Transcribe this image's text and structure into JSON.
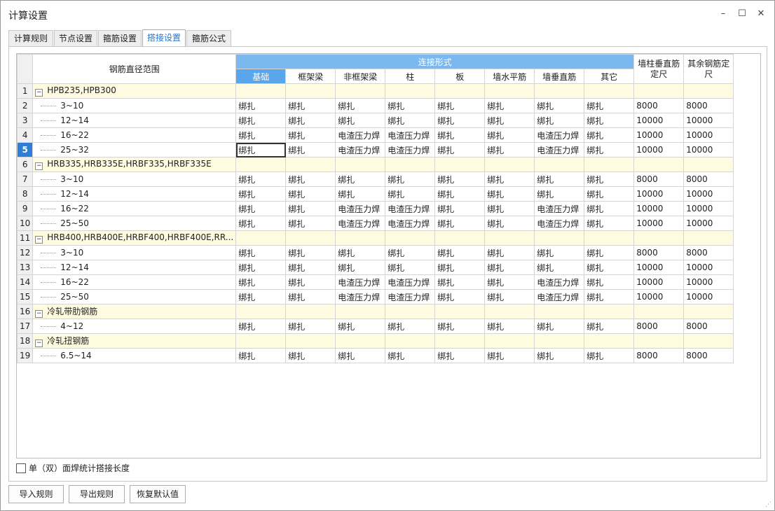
{
  "window": {
    "title": "计算设置",
    "minimize": "–",
    "maximize": "☐",
    "close": "✕"
  },
  "tabs": [
    {
      "label": "计算规则",
      "active": false
    },
    {
      "label": "节点设置",
      "active": false
    },
    {
      "label": "箍筋设置",
      "active": false
    },
    {
      "label": "搭接设置",
      "active": true
    },
    {
      "label": "箍筋公式",
      "active": false
    }
  ],
  "grid": {
    "range_header": "钢筋直径范围",
    "group_header": "连接形式",
    "columns": [
      "基础",
      "框架梁",
      "非框架梁",
      "柱",
      "板",
      "墙水平筋",
      "墙垂直筋",
      "其它"
    ],
    "extra_headers": [
      "墙柱垂直筋定尺",
      "其余钢筋定尺"
    ],
    "selected_row": 5,
    "focused_cell": {
      "row": 5,
      "col": 0
    },
    "rows": [
      {
        "num": "1",
        "type": "group",
        "range": "HPB235,HPB300",
        "values": [
          "",
          "",
          "",
          "",
          "",
          "",
          "",
          "",
          "",
          ""
        ]
      },
      {
        "num": "2",
        "type": "item",
        "range": "3~10",
        "values": [
          "绑扎",
          "绑扎",
          "绑扎",
          "绑扎",
          "绑扎",
          "绑扎",
          "绑扎",
          "绑扎",
          "8000",
          "8000"
        ]
      },
      {
        "num": "3",
        "type": "item",
        "range": "12~14",
        "values": [
          "绑扎",
          "绑扎",
          "绑扎",
          "绑扎",
          "绑扎",
          "绑扎",
          "绑扎",
          "绑扎",
          "10000",
          "10000"
        ]
      },
      {
        "num": "4",
        "type": "item",
        "range": "16~22",
        "values": [
          "绑扎",
          "绑扎",
          "电渣压力焊",
          "电渣压力焊",
          "绑扎",
          "绑扎",
          "电渣压力焊",
          "绑扎",
          "10000",
          "10000"
        ]
      },
      {
        "num": "5",
        "type": "item",
        "range": "25~32",
        "values": [
          "绑扎",
          "绑扎",
          "电渣压力焊",
          "电渣压力焊",
          "绑扎",
          "绑扎",
          "电渣压力焊",
          "绑扎",
          "10000",
          "10000"
        ]
      },
      {
        "num": "6",
        "type": "group",
        "range": "HRB335,HRB335E,HRBF335,HRBF335E",
        "values": [
          "",
          "",
          "",
          "",
          "",
          "",
          "",
          "",
          "",
          ""
        ]
      },
      {
        "num": "7",
        "type": "item",
        "range": "3~10",
        "values": [
          "绑扎",
          "绑扎",
          "绑扎",
          "绑扎",
          "绑扎",
          "绑扎",
          "绑扎",
          "绑扎",
          "8000",
          "8000"
        ]
      },
      {
        "num": "8",
        "type": "item",
        "range": "12~14",
        "values": [
          "绑扎",
          "绑扎",
          "绑扎",
          "绑扎",
          "绑扎",
          "绑扎",
          "绑扎",
          "绑扎",
          "10000",
          "10000"
        ]
      },
      {
        "num": "9",
        "type": "item",
        "range": "16~22",
        "values": [
          "绑扎",
          "绑扎",
          "电渣压力焊",
          "电渣压力焊",
          "绑扎",
          "绑扎",
          "电渣压力焊",
          "绑扎",
          "10000",
          "10000"
        ]
      },
      {
        "num": "10",
        "type": "item",
        "range": "25~50",
        "values": [
          "绑扎",
          "绑扎",
          "电渣压力焊",
          "电渣压力焊",
          "绑扎",
          "绑扎",
          "电渣压力焊",
          "绑扎",
          "10000",
          "10000"
        ]
      },
      {
        "num": "11",
        "type": "group",
        "range": "HRB400,HRB400E,HRBF400,HRBF400E,RR...",
        "values": [
          "",
          "",
          "",
          "",
          "",
          "",
          "",
          "",
          "",
          ""
        ]
      },
      {
        "num": "12",
        "type": "item",
        "range": "3~10",
        "values": [
          "绑扎",
          "绑扎",
          "绑扎",
          "绑扎",
          "绑扎",
          "绑扎",
          "绑扎",
          "绑扎",
          "8000",
          "8000"
        ]
      },
      {
        "num": "13",
        "type": "item",
        "range": "12~14",
        "values": [
          "绑扎",
          "绑扎",
          "绑扎",
          "绑扎",
          "绑扎",
          "绑扎",
          "绑扎",
          "绑扎",
          "10000",
          "10000"
        ]
      },
      {
        "num": "14",
        "type": "item",
        "range": "16~22",
        "values": [
          "绑扎",
          "绑扎",
          "电渣压力焊",
          "电渣压力焊",
          "绑扎",
          "绑扎",
          "电渣压力焊",
          "绑扎",
          "10000",
          "10000"
        ]
      },
      {
        "num": "15",
        "type": "item",
        "range": "25~50",
        "values": [
          "绑扎",
          "绑扎",
          "电渣压力焊",
          "电渣压力焊",
          "绑扎",
          "绑扎",
          "电渣压力焊",
          "绑扎",
          "10000",
          "10000"
        ]
      },
      {
        "num": "16",
        "type": "group",
        "range": "冷轧带肋钢筋",
        "values": [
          "",
          "",
          "",
          "",
          "",
          "",
          "",
          "",
          "",
          ""
        ]
      },
      {
        "num": "17",
        "type": "item",
        "range": "4~12",
        "values": [
          "绑扎",
          "绑扎",
          "绑扎",
          "绑扎",
          "绑扎",
          "绑扎",
          "绑扎",
          "绑扎",
          "8000",
          "8000"
        ]
      },
      {
        "num": "18",
        "type": "group",
        "range": "冷轧扭钢筋",
        "values": [
          "",
          "",
          "",
          "",
          "",
          "",
          "",
          "",
          "",
          ""
        ]
      },
      {
        "num": "19",
        "type": "item",
        "range": "6.5~14",
        "values": [
          "绑扎",
          "绑扎",
          "绑扎",
          "绑扎",
          "绑扎",
          "绑扎",
          "绑扎",
          "绑扎",
          "8000",
          "8000"
        ]
      }
    ]
  },
  "checkbox": {
    "label": "单（双）面焊统计搭接长度",
    "checked": false
  },
  "buttons": {
    "import": "导入规则",
    "export": "导出规则",
    "restore": "恢复默认值"
  },
  "colors": {
    "header_blue": "#7ab8ef",
    "group_row_bg": "#fffbe0",
    "selected_row_num": "#2d7fd6",
    "active_tab_text": "#2a76c9"
  }
}
